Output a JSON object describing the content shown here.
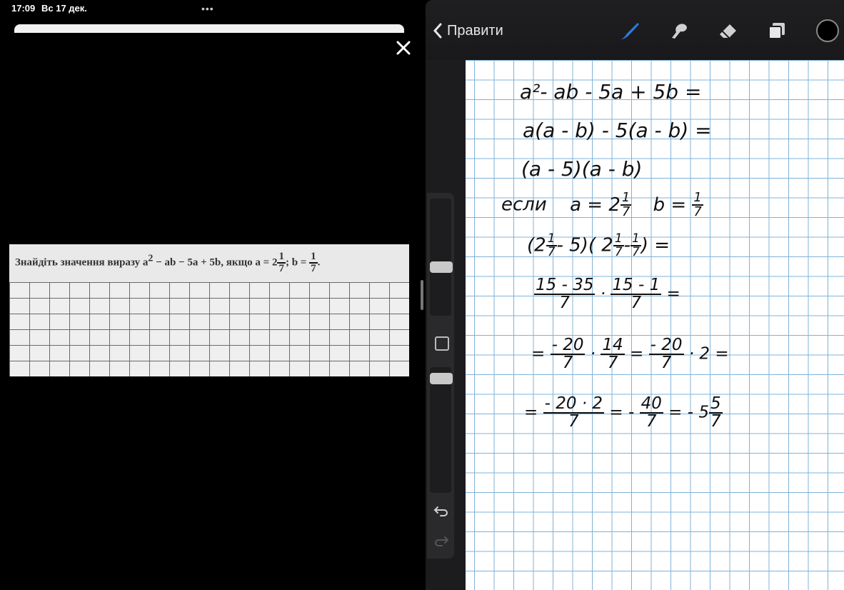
{
  "status_bar": {
    "time": "17:09",
    "date": "Вс 17 дек.",
    "multitask": "•••"
  },
  "viewer": {
    "task_text": "Знайдіть значення виразу a",
    "task_text_exp": "2",
    "task_text_2": " − ab − 5a + 5b, якщо a = 2",
    "task_frac_num": "1",
    "task_frac_den": "7",
    "task_text_3": "; b = ",
    "task_frac2_num": "1",
    "task_frac2_den": "7",
    "task_text_4": "."
  },
  "toolbar": {
    "back_label": "Правити",
    "icons": [
      "brush-icon",
      "smudge-icon",
      "eraser-icon",
      "layers-icon"
    ],
    "accent_color": "#2f7bd8"
  },
  "notes": {
    "line1": "a²- ab - 5a + 5b =",
    "line2": "a(a - b) - 5(a - b) =",
    "line3": "(a - 5)(a - b)",
    "line4a": "если",
    "line4b": "a = 2",
    "line4_num": "1",
    "line4_den": "7",
    "line4c": "b =",
    "line4d_num": "1",
    "line4d_den": "7",
    "line5a": "(2",
    "line5_num": "1",
    "line5_den": "7",
    "line5b": "- 5)( 2",
    "line5c_num": "1",
    "line5c_den": "7",
    "line5d": "-",
    "line5e_num": "1",
    "line5e_den": "7",
    "line5f": ") =",
    "line6_n1": "15 - 35",
    "line6_d1": "7",
    "line6_dot": "·",
    "line6_n2": "15 - 1",
    "line6_d2": "7",
    "line6_eq": "=",
    "line7_pre": "=",
    "line7_n1": "- 20",
    "line7_d1": "7",
    "line7_dot": "·",
    "line7_n2": "14",
    "line7_d2": "7",
    "line7_eq": "=",
    "line7_n3": "- 20",
    "line7_d3": "7",
    "line7_tail": "· 2 =",
    "line8_pre": "=",
    "line8_n1": "- 20 · 2",
    "line8_d1": "7",
    "line8_eq": "= -",
    "line8_n2": "40",
    "line8_d2": "7",
    "line8_eq2": "= - 5",
    "line8_n3": "5",
    "line8_d3": "7"
  }
}
